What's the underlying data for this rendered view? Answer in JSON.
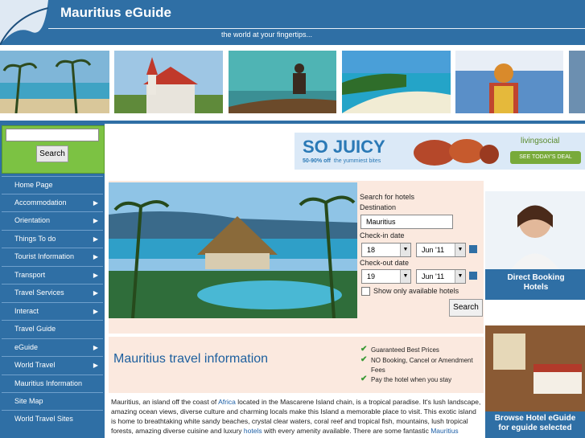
{
  "header": {
    "title": "Mauritius eGuide",
    "tagline": "the world at your fingertips..."
  },
  "sidebar": {
    "search_button": "Search",
    "items": [
      {
        "label": "Home Page",
        "arrow": ""
      },
      {
        "label": "Accommodation",
        "arrow": "▶"
      },
      {
        "label": "Orientation",
        "arrow": "▶"
      },
      {
        "label": "Things To do",
        "arrow": "▶"
      },
      {
        "label": "Tourist Information",
        "arrow": "▶"
      },
      {
        "label": "Transport",
        "arrow": "▶"
      },
      {
        "label": "Travel Services",
        "arrow": "▶"
      },
      {
        "label": "Interact",
        "arrow": "▶"
      },
      {
        "label": "Travel Guide",
        "arrow": ""
      },
      {
        "label": "eGuide",
        "arrow": "▶"
      },
      {
        "label": "World Travel",
        "arrow": "▶"
      },
      {
        "label": "Mauritius Information",
        "arrow": ""
      },
      {
        "label": "Site Map",
        "arrow": ""
      },
      {
        "label": "World Travel Sites",
        "arrow": ""
      }
    ]
  },
  "banner": {
    "headline": "SO JUICY",
    "sub_discount": "50-90% off",
    "sub_text": "the yummiest bites",
    "brand": "livingsocial",
    "cta": "SEE TODAY'S DEAL"
  },
  "booking": {
    "search_label": "Search for hotels",
    "destination_label": "Destination",
    "destination_value": "Mauritius",
    "checkin_label": "Check-in date",
    "checkin_day": "18",
    "checkin_month": "Jun '11",
    "checkout_label": "Check-out date",
    "checkout_day": "19",
    "checkout_month": "Jun '11",
    "available_label": "Show only available hotels",
    "search_button": "Search"
  },
  "info": {
    "heading": "Mauritius travel information",
    "features": [
      "Guaranteed Best Prices",
      "NO Booking, Cancel or Amendment",
      "Fees",
      "Pay the hotel when you stay"
    ]
  },
  "body": {
    "p1": "Mauritius, an island off the coast of ",
    "link_africa": "Africa",
    "p2": " located in the Mascarene Island chain, is a tropical paradise.  It's lush landscape, amazing ocean views, diverse culture and charming locals make this Island a memorable place to visit.  This exotic island is home to breathtaking white sandy beaches, crystal clear waters, coral reef and tropical fish, mountains, lush tropical forests, amazing diverse cuisine and luxury ",
    "link_hotels": "hotels",
    "p3": " with every amenity available. There are some fantastic ",
    "link_mauritius": "Mauritius"
  },
  "ads": {
    "ad1_line1": "Direct Booking",
    "ad1_line2": "Hotels",
    "ad2_line1": "Browse Hotel eGuide",
    "ad2_line2": "for eguide selected"
  },
  "colors": {
    "brand_blue": "#2f6fa5",
    "sidebar_green": "#7cc243",
    "panel_peach": "#fbe9df"
  }
}
